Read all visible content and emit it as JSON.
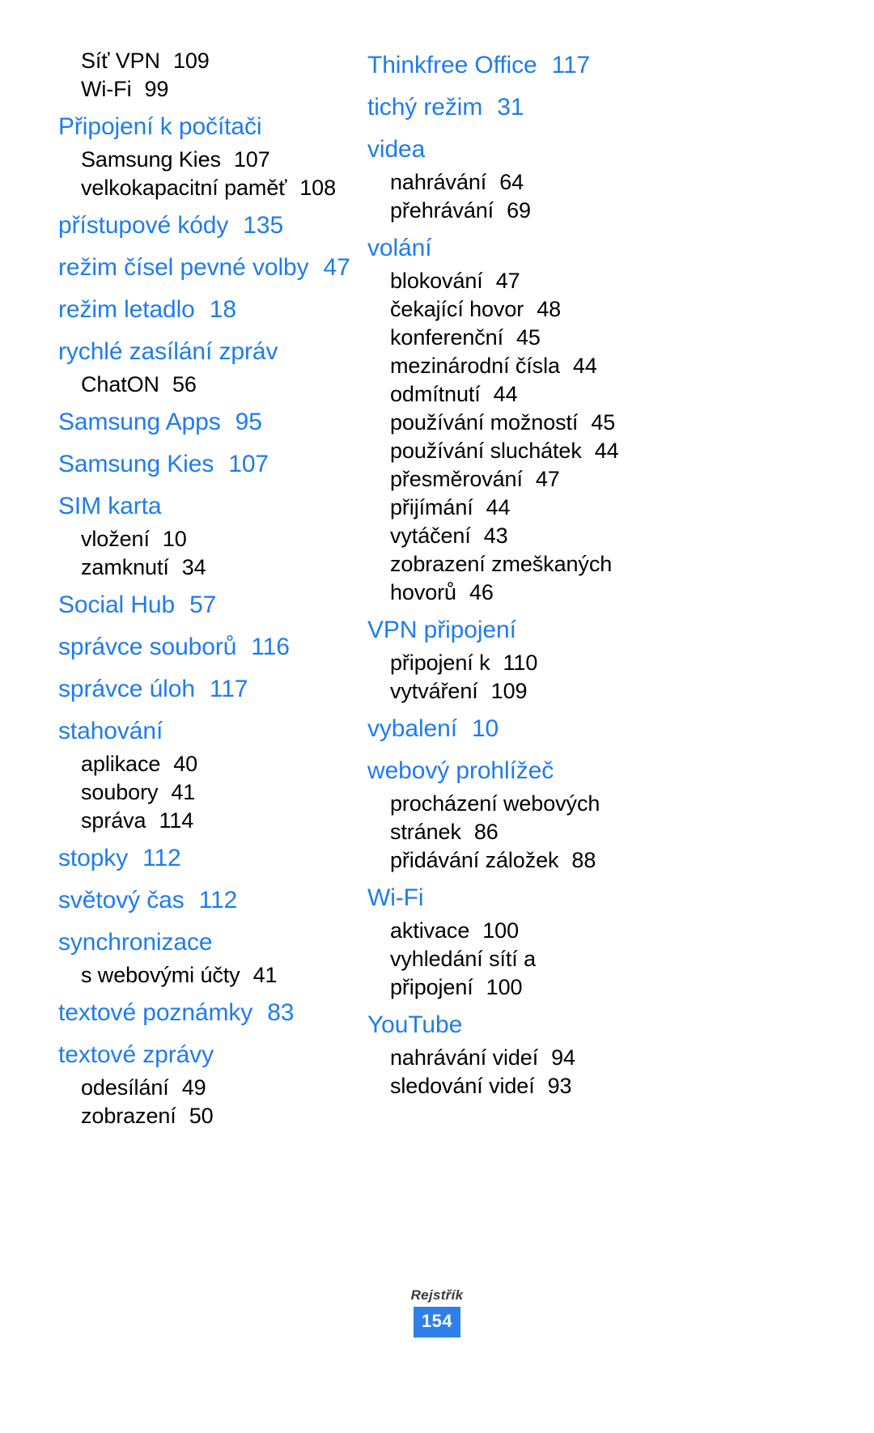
{
  "document": {
    "language": "cs",
    "accent_color": "#1f7bf0",
    "page_number_bg": "#2f7fe8",
    "body_color": "#000000"
  },
  "footer": {
    "section_label": "Rejstřík",
    "page_number": "154"
  },
  "index": {
    "left_column": [
      {
        "type": "sub",
        "label": "Síť VPN",
        "page": "109"
      },
      {
        "type": "sub",
        "label": "Wi-Fi",
        "page": "99"
      },
      {
        "type": "main",
        "label": "Připojení k počítači",
        "page": ""
      },
      {
        "type": "sub",
        "label": "Samsung Kies",
        "page": "107"
      },
      {
        "type": "sub",
        "label": "velkokapacitní paměť",
        "page": "108"
      },
      {
        "type": "main",
        "label": "přístupové kódy",
        "page": "135"
      },
      {
        "type": "main",
        "label": "režim čísel pevné volby",
        "page": "47"
      },
      {
        "type": "main",
        "label": "režim letadlo",
        "page": "18"
      },
      {
        "type": "main",
        "label": "rychlé zasílání zpráv",
        "page": ""
      },
      {
        "type": "sub",
        "label": "ChatON",
        "page": "56"
      },
      {
        "type": "main",
        "label": "Samsung Apps",
        "page": "95"
      },
      {
        "type": "main",
        "label": "Samsung Kies",
        "page": "107"
      },
      {
        "type": "main",
        "label": "SIM karta",
        "page": ""
      },
      {
        "type": "sub",
        "label": "vložení",
        "page": "10"
      },
      {
        "type": "sub",
        "label": "zamknutí",
        "page": "34"
      },
      {
        "type": "main",
        "label": "Social Hub",
        "page": "57"
      },
      {
        "type": "main",
        "label": "správce souborů",
        "page": "116"
      },
      {
        "type": "main",
        "label": "správce úloh",
        "page": "117"
      },
      {
        "type": "main",
        "label": "stahování",
        "page": ""
      },
      {
        "type": "sub",
        "label": "aplikace",
        "page": "40"
      },
      {
        "type": "sub",
        "label": "soubory",
        "page": "41"
      },
      {
        "type": "sub",
        "label": "správa",
        "page": "114"
      },
      {
        "type": "main",
        "label": "stopky",
        "page": "112"
      },
      {
        "type": "main",
        "label": "světový čas",
        "page": "112"
      },
      {
        "type": "main",
        "label": "synchronizace",
        "page": ""
      },
      {
        "type": "sub",
        "label": "s webovými účty",
        "page": "41"
      },
      {
        "type": "main",
        "label": "textové poznámky",
        "page": "83"
      },
      {
        "type": "main",
        "label": "textové zprávy",
        "page": ""
      },
      {
        "type": "sub",
        "label": "odesílání",
        "page": "49"
      },
      {
        "type": "sub",
        "label": "zobrazení",
        "page": "50"
      }
    ],
    "right_column": [
      {
        "type": "main",
        "label": "Thinkfree Office",
        "page": "117"
      },
      {
        "type": "main",
        "label": "tichý režim",
        "page": "31"
      },
      {
        "type": "main",
        "label": "videa",
        "page": ""
      },
      {
        "type": "sub",
        "label": "nahrávání",
        "page": "64"
      },
      {
        "type": "sub",
        "label": "přehrávání",
        "page": "69"
      },
      {
        "type": "main",
        "label": "volání",
        "page": ""
      },
      {
        "type": "sub",
        "label": "blokování",
        "page": "47"
      },
      {
        "type": "sub",
        "label": "čekající hovor",
        "page": "48"
      },
      {
        "type": "sub",
        "label": "konferenční",
        "page": "45"
      },
      {
        "type": "sub",
        "label": "mezinárodní čísla",
        "page": "44"
      },
      {
        "type": "sub",
        "label": "odmítnutí",
        "page": "44"
      },
      {
        "type": "sub",
        "label": "používání možností",
        "page": "45"
      },
      {
        "type": "sub",
        "label": "používání sluchátek",
        "page": "44"
      },
      {
        "type": "sub",
        "label": "přesměrování",
        "page": "47"
      },
      {
        "type": "sub",
        "label": "přijímání",
        "page": "44"
      },
      {
        "type": "sub",
        "label": "vytáčení",
        "page": "43"
      },
      {
        "type": "sub",
        "label": "zobrazení zmeškaných",
        "page": ""
      },
      {
        "type": "sub",
        "label": "hovorů",
        "page": "46",
        "continuation": true
      },
      {
        "type": "main",
        "label": "VPN připojení",
        "page": ""
      },
      {
        "type": "sub",
        "label": "připojení k",
        "page": "110"
      },
      {
        "type": "sub",
        "label": "vytváření",
        "page": "109"
      },
      {
        "type": "main",
        "label": "vybalení",
        "page": "10"
      },
      {
        "type": "main",
        "label": "webový prohlížeč",
        "page": ""
      },
      {
        "type": "sub",
        "label": "procházení webových",
        "page": ""
      },
      {
        "type": "sub",
        "label": "stránek",
        "page": "86",
        "continuation": true
      },
      {
        "type": "sub",
        "label": "přidávání záložek",
        "page": "88"
      },
      {
        "type": "main",
        "label": "Wi-Fi",
        "page": ""
      },
      {
        "type": "sub",
        "label": "aktivace",
        "page": "100"
      },
      {
        "type": "sub",
        "label": "vyhledání sítí a",
        "page": ""
      },
      {
        "type": "sub",
        "label": "připojení",
        "page": "100",
        "continuation": true
      },
      {
        "type": "main",
        "label": "YouTube",
        "page": ""
      },
      {
        "type": "sub",
        "label": "nahrávání videí",
        "page": "94"
      },
      {
        "type": "sub",
        "label": "sledování videí",
        "page": "93"
      }
    ]
  }
}
